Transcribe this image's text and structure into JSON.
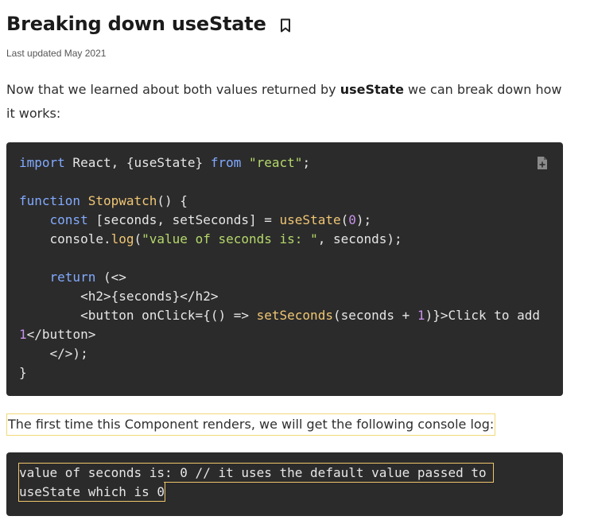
{
  "heading": {
    "title": "Breaking down useState",
    "updated": "Last updated May 2021"
  },
  "intro": {
    "before": "Now that we learned about both values returned by ",
    "bold": "useState",
    "after": " we can break down how it works:"
  },
  "code": {
    "language": "jsx",
    "line1": {
      "kw_import": "import",
      "t1": " React, {useState} ",
      "kw_from": "from",
      "t2": " ",
      "str": "\"react\"",
      "t3": ";"
    },
    "line3": {
      "kw_function": "function",
      "t1": " ",
      "fn": "Stopwatch",
      "t2": "() {"
    },
    "line4": {
      "t0": "    ",
      "kw_const": "const",
      "t1": " [seconds, setSeconds] = ",
      "fn": "useState",
      "t2": "(",
      "num": "0",
      "t3": ");"
    },
    "line5": {
      "t0": "    console.",
      "fn": "log",
      "t1": "(",
      "str": "\"value of seconds is: \"",
      "t2": ", seconds);"
    },
    "line7": {
      "t0": "    ",
      "kw_return": "return",
      "t1": " (<>"
    },
    "line8": "        <h2>{seconds}</h2>",
    "line9": {
      "t0": "        <button onClick={() => ",
      "fn": "setSeconds",
      "t1": "(seconds + ",
      "num": "1",
      "t2": ")}>Click to add"
    },
    "line10": {
      "num": "1",
      "t1": "</button>"
    },
    "line11": "    </>);",
    "line12": "}",
    "copy_icon": "copy-file-icon"
  },
  "caption": "The first time this Component renders, we will get the following console log:",
  "output": {
    "line1": "value of seconds is: 0 // it uses the default value passed to",
    "line2": "useState which is 0"
  },
  "colors": {
    "code_bg": "#2b2b2b",
    "keyword": "#82aaff",
    "function": "#f0c674",
    "string": "#b5d86b",
    "number": "#c792ea",
    "highlight_border": "#f0c66b"
  }
}
